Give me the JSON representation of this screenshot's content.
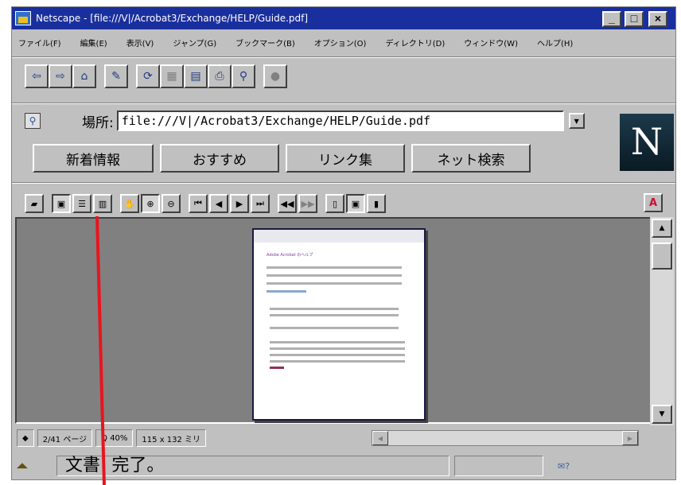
{
  "window": {
    "title": "Netscape - [file:///V|/Acrobat3/Exchange/HELP/Guide.pdf]",
    "minimize": "_",
    "maximize": "□",
    "close": "×"
  },
  "menu": [
    "ファイル(F)",
    "編集(E)",
    "表示(V)",
    "ジャンプ(G)",
    "ブックマーク(B)",
    "オプション(O)",
    "ディレクトリ(D)",
    "ウィンドウ(W)",
    "ヘルプ(H)"
  ],
  "toolbar": {
    "back": "⇦",
    "forward": "⇨",
    "home": "⌂",
    "edit": "✎",
    "reload": "⟳",
    "images": "▦",
    "open": "▤",
    "print": "⎙",
    "find": "⚲",
    "stop": "●"
  },
  "location": {
    "label": "場所:",
    "url": "file:///V|/Acrobat3/Exchange/HELP/Guide.pdf",
    "dropdown": "▼",
    "bookmark_icon": "⚲"
  },
  "logo": "N",
  "directory": [
    "新着情報",
    "おすすめ",
    "リンク集",
    "ネット検索"
  ],
  "acrobat": {
    "buttons": [
      "▰",
      "▣",
      "☰",
      "▥",
      "✋",
      "⊕",
      "⊖",
      "⏮",
      "◀",
      "▶",
      "⏭",
      "◀◀",
      "▶▶",
      "▯",
      "▣",
      "▮"
    ],
    "logo": "A"
  },
  "document": {
    "thumb_title": "Adobe Acrobat のヘルプ"
  },
  "doc_status": {
    "page": "2/41 ページ",
    "zoom": "Q 40%",
    "size": "115 x 132 ミリ"
  },
  "scroll": {
    "up": "▲",
    "down": "▼",
    "left": "◀",
    "right": "▶"
  },
  "status": {
    "text": "文書: 完了。",
    "security": "◢◣",
    "mail": "✉?"
  }
}
